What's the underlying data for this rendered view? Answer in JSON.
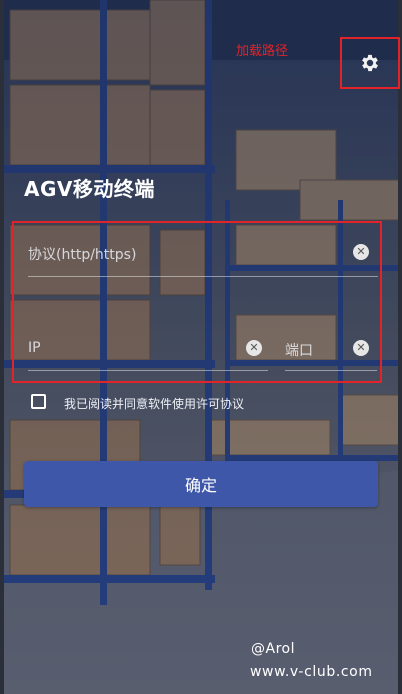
{
  "annotation": {
    "text": "加载路径",
    "color": "#e0242a"
  },
  "header": {
    "title": "AGV移动终端"
  },
  "form": {
    "protocol_placeholder": "协议(http/https)",
    "ip_placeholder": "IP",
    "port_placeholder": "端口",
    "clear_glyph": "✕"
  },
  "agreement": {
    "text": "我已阅读并同意软件使用许可协议",
    "checked": false
  },
  "confirm": {
    "label": "确定",
    "color": "#3f57a8"
  },
  "watermark": {
    "author": "@Arol",
    "site": "www.v-club.com"
  },
  "icons": {
    "settings": "gear-icon"
  }
}
